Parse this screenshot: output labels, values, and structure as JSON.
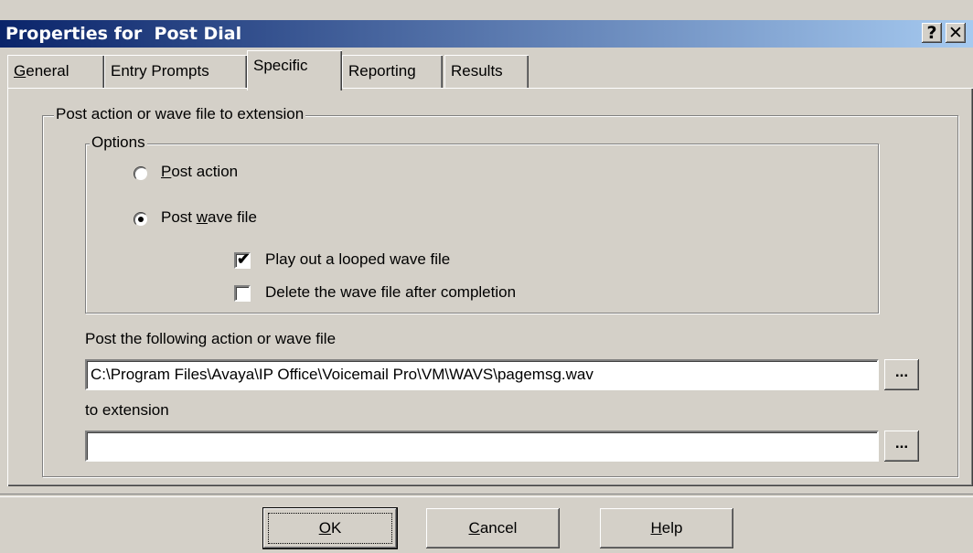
{
  "window": {
    "title": "Properties for  Post Dial",
    "help_button": "?",
    "close_button": "✕"
  },
  "tabs": [
    {
      "label_first": "G",
      "label_rest": "eneral",
      "active": false
    },
    {
      "label": "Entry Prompts",
      "active": false
    },
    {
      "label": "Specific",
      "active": true
    },
    {
      "label": "Reporting",
      "active": false
    },
    {
      "label": "Results",
      "active": false
    }
  ],
  "main_group": {
    "legend": "Post action or wave file to extension",
    "options_group": {
      "legend": "Options",
      "post_action": {
        "label_first": "P",
        "label_rest": "ost action",
        "selected": false
      },
      "post_wave": {
        "label_pre": "Post ",
        "label_u": "w",
        "label_rest": "ave file",
        "selected": true
      },
      "loop_wave": {
        "label": "Play out a looped wave file",
        "checked": true
      },
      "delete_wave": {
        "label": "Delete the wave file after completion",
        "checked": false
      }
    },
    "action_field": {
      "label": "Post the following action or wave file",
      "value": "C:\\Program Files\\Avaya\\IP Office\\Voicemail Pro\\VM\\WAVS\\pagemsg.wav",
      "browse": "..."
    },
    "extension_field": {
      "label": "to extension",
      "value": "",
      "browse": "..."
    }
  },
  "buttons": {
    "ok_first": "O",
    "ok_rest": "K",
    "cancel_first": "C",
    "cancel_rest": "ancel",
    "help_first": "H",
    "help_rest": "elp"
  }
}
